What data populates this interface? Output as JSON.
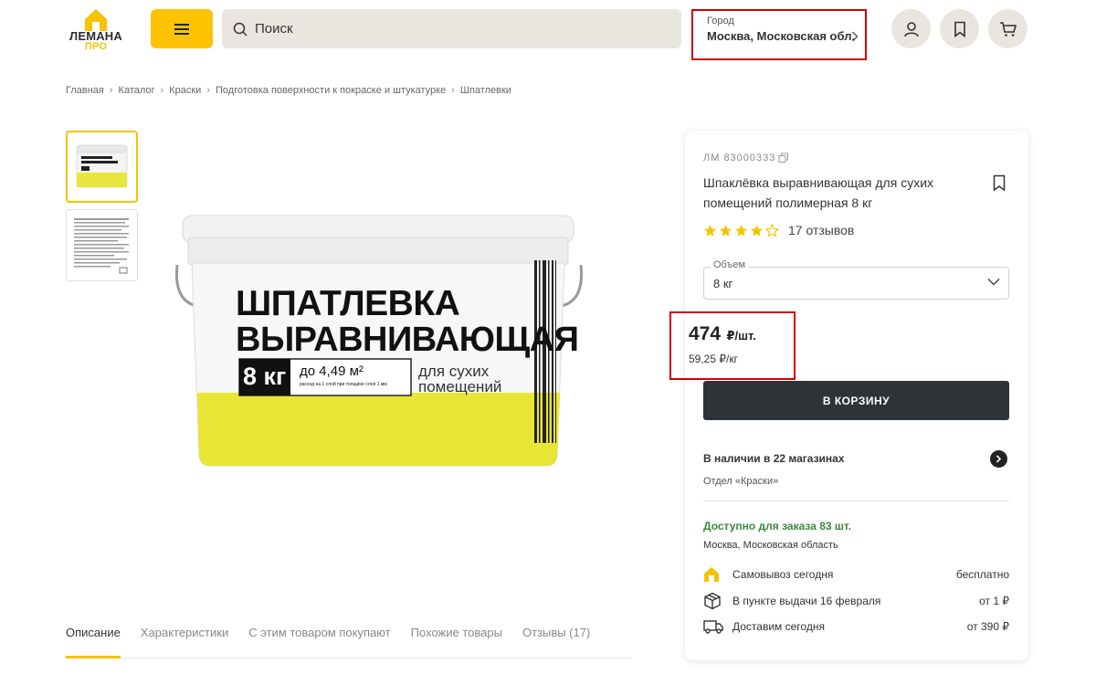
{
  "header": {
    "logo_text": "ЛЕМАНА",
    "logo_sub": "ПРО",
    "search_placeholder": "Поиск",
    "city_label": "Город",
    "city_value": "Москва, Московская обл."
  },
  "breadcrumb": [
    "Главная",
    "Каталог",
    "Краски",
    "Подготовка поверхности к покраске и штукатурке",
    "Шпатлевки"
  ],
  "product_image": {
    "line1": "ШПАТЛЕВКА",
    "line2": "ВЫРАВНИВАЮЩАЯ",
    "weight": "8 кг",
    "coverage": "до 4,49 м²",
    "coverage_note": "расход на 1 слой при толщине слоя 1 мм",
    "usage_line1": "для сухих",
    "usage_line2": "помещений"
  },
  "tabs": [
    "Описание",
    "Характеристики",
    "С этим товаром покупают",
    "Похожие товары",
    "Отзывы (17)"
  ],
  "card": {
    "sku": "ЛМ 83000333",
    "title": "Шпаклёвка выравнивающая для сухих помещений полимерная 8 кг",
    "rating": 4,
    "reviews": "17 отзывов",
    "volume_label": "Объем",
    "volume_value": "8 кг",
    "price": "474",
    "price_unit": "₽/шт.",
    "price_per_kg": "59,25 ₽/кг",
    "cart_button": "В КОРЗИНУ",
    "availability": "В наличии в 22 магазинах",
    "department": "Отдел «Краски»",
    "order_available": "Доступно для заказа 83 шт.",
    "region": "Москва, Московская область",
    "delivery": [
      {
        "label": "Самовывоз сегодня",
        "price": "бесплатно",
        "icon": "store-icon"
      },
      {
        "label": "В пункте выдачи 16 февраля",
        "price": "от 1 ₽",
        "icon": "box-icon"
      },
      {
        "label": "Доставим сегодня",
        "price": "от 390 ₽",
        "icon": "truck-icon"
      }
    ]
  },
  "colors": {
    "accent": "#fdc300",
    "dark_button": "#2f3338",
    "highlight_border": "#d10000",
    "success": "#3b8a3b"
  }
}
